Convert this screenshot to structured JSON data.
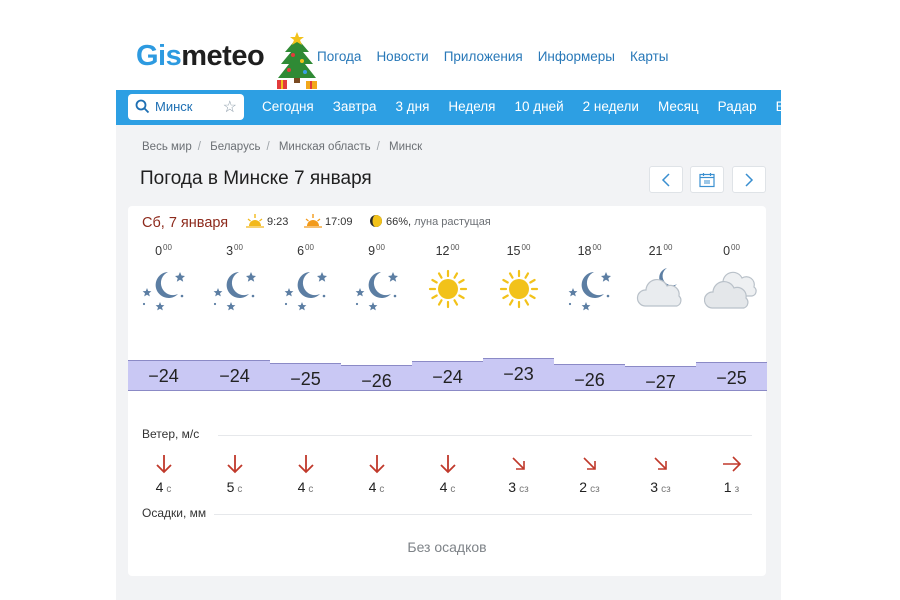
{
  "header": {
    "logo_gis": "Gis",
    "logo_meteo": "meteo",
    "nav": [
      "Погода",
      "Новости",
      "Приложения",
      "Информеры",
      "Карты"
    ]
  },
  "search": {
    "value": "Минск"
  },
  "daynav": [
    "Сегодня",
    "Завтра",
    "3 дня",
    "Неделя",
    "10 дней",
    "2 недели",
    "Месяц",
    "Радар",
    "Еж"
  ],
  "breadcrumbs": [
    "Весь мир",
    "Беларусь",
    "Минская область",
    "Минск"
  ],
  "page_title": "Погода в Минске 7 января",
  "card": {
    "date": "Сб, 7 января",
    "sunrise": "9:23",
    "sunset": "17:09",
    "moon_pct": "66%,",
    "moon_phase": "луна растущая",
    "hours": [
      {
        "h": "0",
        "m": "00",
        "icon": "night-clear",
        "temp": "−24",
        "wind": "4",
        "dir": "с",
        "arrow": "south"
      },
      {
        "h": "3",
        "m": "00",
        "icon": "night-clear",
        "temp": "−24",
        "wind": "5",
        "dir": "с",
        "arrow": "south"
      },
      {
        "h": "6",
        "m": "00",
        "icon": "night-clear",
        "temp": "−25",
        "wind": "4",
        "dir": "с",
        "arrow": "south"
      },
      {
        "h": "9",
        "m": "00",
        "icon": "night-clear",
        "temp": "−26",
        "wind": "4",
        "dir": "с",
        "arrow": "south"
      },
      {
        "h": "12",
        "m": "00",
        "icon": "sun",
        "temp": "−24",
        "wind": "4",
        "dir": "с",
        "arrow": "south"
      },
      {
        "h": "15",
        "m": "00",
        "icon": "sun",
        "temp": "−23",
        "wind": "3",
        "dir": "сз",
        "arrow": "southeast"
      },
      {
        "h": "18",
        "m": "00",
        "icon": "night-clear",
        "temp": "−26",
        "wind": "2",
        "dir": "сз",
        "arrow": "southeast"
      },
      {
        "h": "21",
        "m": "00",
        "icon": "night-cloudy",
        "temp": "−27",
        "wind": "3",
        "dir": "сз",
        "arrow": "southeast"
      },
      {
        "h": "0",
        "m": "00",
        "icon": "cloudy",
        "temp": "−25",
        "wind": "1",
        "dir": "з",
        "arrow": "east"
      }
    ],
    "wind_label": "Ветер, м/с",
    "precip_label": "Осадки, мм",
    "no_precip": "Без осадков"
  },
  "colors": {
    "accent": "#2d9fe3",
    "date": "#8d2a1c",
    "temp_band": "#c9c8f4",
    "wind_arrow": "#c0392b"
  }
}
